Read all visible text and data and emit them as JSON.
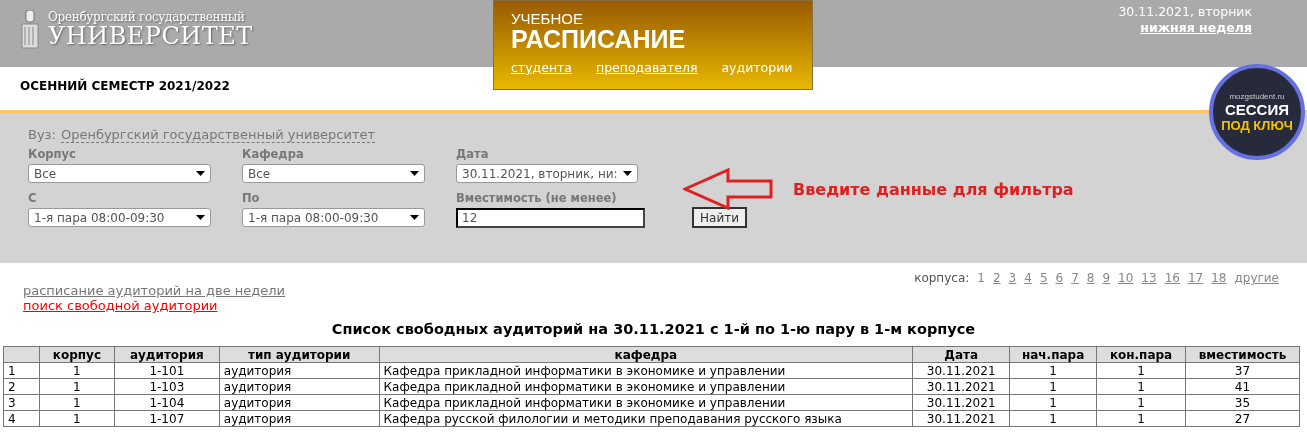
{
  "header": {
    "logo_line1": "Оренбургский государственный",
    "logo_line2": "УНИВЕРСИТЕТ",
    "title_small": "УЧЕБНОЕ",
    "title_big": "РАСПИСАНИЕ",
    "nav": [
      {
        "label": "студента",
        "selected": false
      },
      {
        "label": "преподавателя",
        "selected": false
      },
      {
        "label": "аудитории",
        "selected": true
      }
    ],
    "date": "30.11.2021, вторник",
    "week": "нижняя неделя",
    "semester": "ОСЕННИЙ СЕМЕСТР 2021/2022",
    "badge": {
      "site": "mozgstudent.ru",
      "line1": "СЕССИЯ",
      "line2": "ПОД КЛЮЧ"
    }
  },
  "filter": {
    "vuz_label": "Вуз:",
    "vuz": "Оренбургский государственный университет",
    "fields": [
      {
        "kind": "select",
        "label": "Корпус",
        "value": "Все"
      },
      {
        "kind": "select",
        "label": "Кафедра",
        "value": "Все"
      },
      {
        "kind": "select",
        "label": "Дата",
        "value": "30.11.2021, вторник, ни:"
      },
      {
        "kind": "select",
        "label": "С",
        "value": "1-я пара 08:00-09:30"
      },
      {
        "kind": "select",
        "label": "По",
        "value": "1-я пара 08:00-09:30"
      },
      {
        "kind": "input",
        "label": "Вместимость (не менее)",
        "value": "12"
      }
    ],
    "button": "Найти",
    "hint": "Введите данные для фильтра"
  },
  "links": [
    {
      "label": "расписание аудиторий на две недели",
      "selected": false
    },
    {
      "label": "поиск свободной аудитории",
      "selected": true
    }
  ],
  "buildings": {
    "label": "корпуса:",
    "items": [
      {
        "label": "1",
        "selected": true
      },
      {
        "label": "2",
        "selected": false
      },
      {
        "label": "3",
        "selected": false
      },
      {
        "label": "4",
        "selected": false
      },
      {
        "label": "5",
        "selected": false
      },
      {
        "label": "6",
        "selected": false
      },
      {
        "label": "7",
        "selected": false
      },
      {
        "label": "8",
        "selected": false
      },
      {
        "label": "9",
        "selected": false
      },
      {
        "label": "10",
        "selected": false
      },
      {
        "label": "13",
        "selected": false
      },
      {
        "label": "16",
        "selected": false
      },
      {
        "label": "17",
        "selected": false
      },
      {
        "label": "18",
        "selected": false
      },
      {
        "label": "другие",
        "selected": false
      }
    ]
  },
  "table": {
    "title": "Список свободных аудиторий на 30.11.2021 с 1-й по 1-ю пару в 1-м корпусе",
    "columns": [
      "",
      "корпус",
      "аудитория",
      "тип аудитории",
      "кафедра",
      "Дата",
      "нач.пара",
      "кон.пара",
      "вместимость"
    ],
    "rows": [
      [
        "1",
        "1",
        "1-101",
        "аудитория",
        "Кафедра прикладной информатики в экономике и управлении",
        "30.11.2021",
        "1",
        "1",
        "37"
      ],
      [
        "2",
        "1",
        "1-103",
        "аудитория",
        "Кафедра прикладной информатики в экономике и управлении",
        "30.11.2021",
        "1",
        "1",
        "41"
      ],
      [
        "3",
        "1",
        "1-104",
        "аудитория",
        "Кафедра прикладной информатики в экономике и управлении",
        "30.11.2021",
        "1",
        "1",
        "35"
      ],
      [
        "4",
        "1",
        "1-107",
        "аудитория",
        "Кафедра русской филологии и методики преподавания русского языка",
        "30.11.2021",
        "1",
        "1",
        "27"
      ]
    ]
  }
}
